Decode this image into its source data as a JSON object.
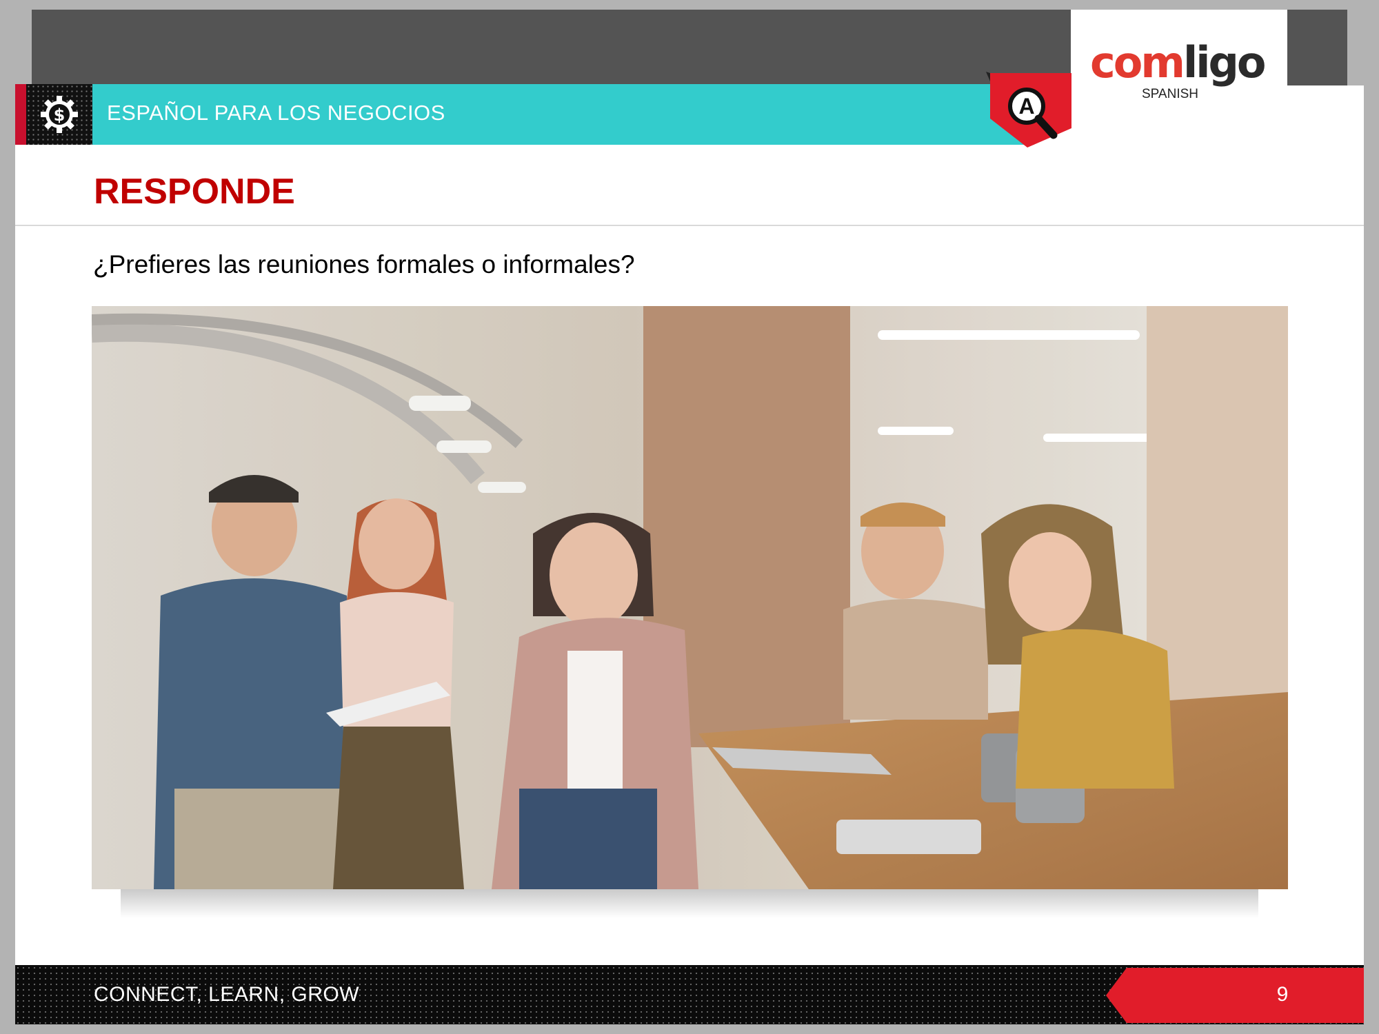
{
  "header": {
    "course_title": "ESPAÑOL PARA LOS NEGOCIOS",
    "course_icon": "dollar-gear-icon",
    "badge_letter": "A",
    "badge_icon": "magnifier-icon"
  },
  "logo": {
    "word_part1": "com",
    "word_part2": "ligo",
    "subtitle": "SPANISH"
  },
  "main": {
    "title": "RESPONDE",
    "question": "¿Prefieres las reuniones formales o informales?",
    "photo_subject": "team-meeting-photo"
  },
  "footer": {
    "tagline": "CONNECT, LEARN, GROW",
    "page_number": "9"
  },
  "colors": {
    "header_teal": "#33cccc",
    "accent_red": "#e11d2a",
    "title_red": "#c00000",
    "top_band_gray": "#545454"
  }
}
